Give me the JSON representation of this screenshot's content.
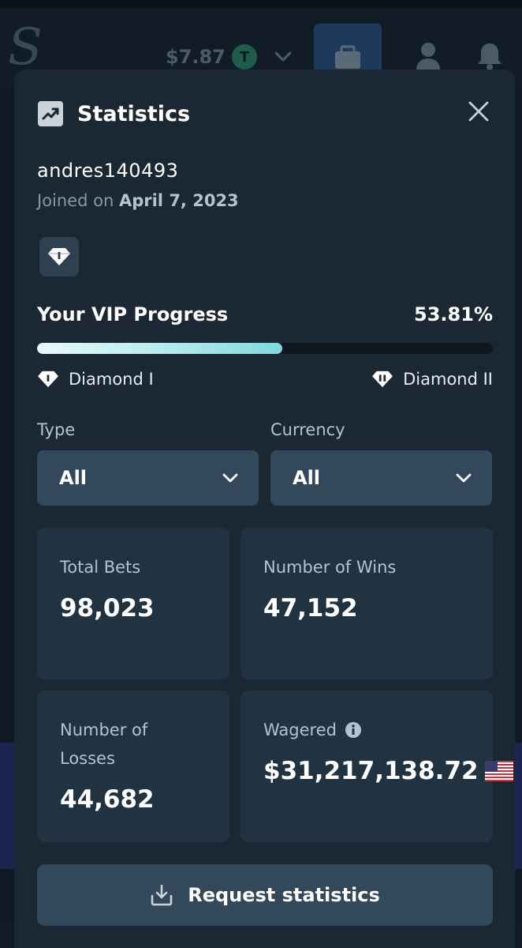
{
  "topbar": {
    "logo": "S",
    "balance": "$7.87",
    "currency_symbol": "T"
  },
  "modal": {
    "title": "Statistics",
    "username": "andres140493",
    "joined_prefix": "Joined on",
    "joined_date": "April 7, 2023",
    "vip": {
      "label": "Your VIP Progress",
      "percent_text": "53.81%",
      "progress": 0.5381,
      "current_rank": "Diamond I",
      "next_rank": "Diamond II"
    },
    "filters": {
      "type_label": "Type",
      "type_value": "All",
      "currency_label": "Currency",
      "currency_value": "All"
    },
    "stats": {
      "total_bets_label": "Total Bets",
      "total_bets": "98,023",
      "wins_label": "Number of Wins",
      "wins": "47,152",
      "losses_label_1": "Number of",
      "losses_label_2": "Losses",
      "losses": "44,682",
      "wagered_label": "Wagered",
      "wagered": "$31,217,138.72"
    },
    "request_button": "Request statistics"
  },
  "colors": {
    "modal_bg": "#1b2833",
    "card_bg": "#213241",
    "control_bg": "#33485a",
    "progress_start": "#e8fafa",
    "progress_end": "#7fd8dc"
  },
  "icons": [
    "stats-chart-icon",
    "close-icon",
    "diamond-icon",
    "chevron-down-icon",
    "info-icon",
    "us-flag-icon",
    "download-icon",
    "user-icon",
    "bell-icon",
    "wallet-icon"
  ]
}
